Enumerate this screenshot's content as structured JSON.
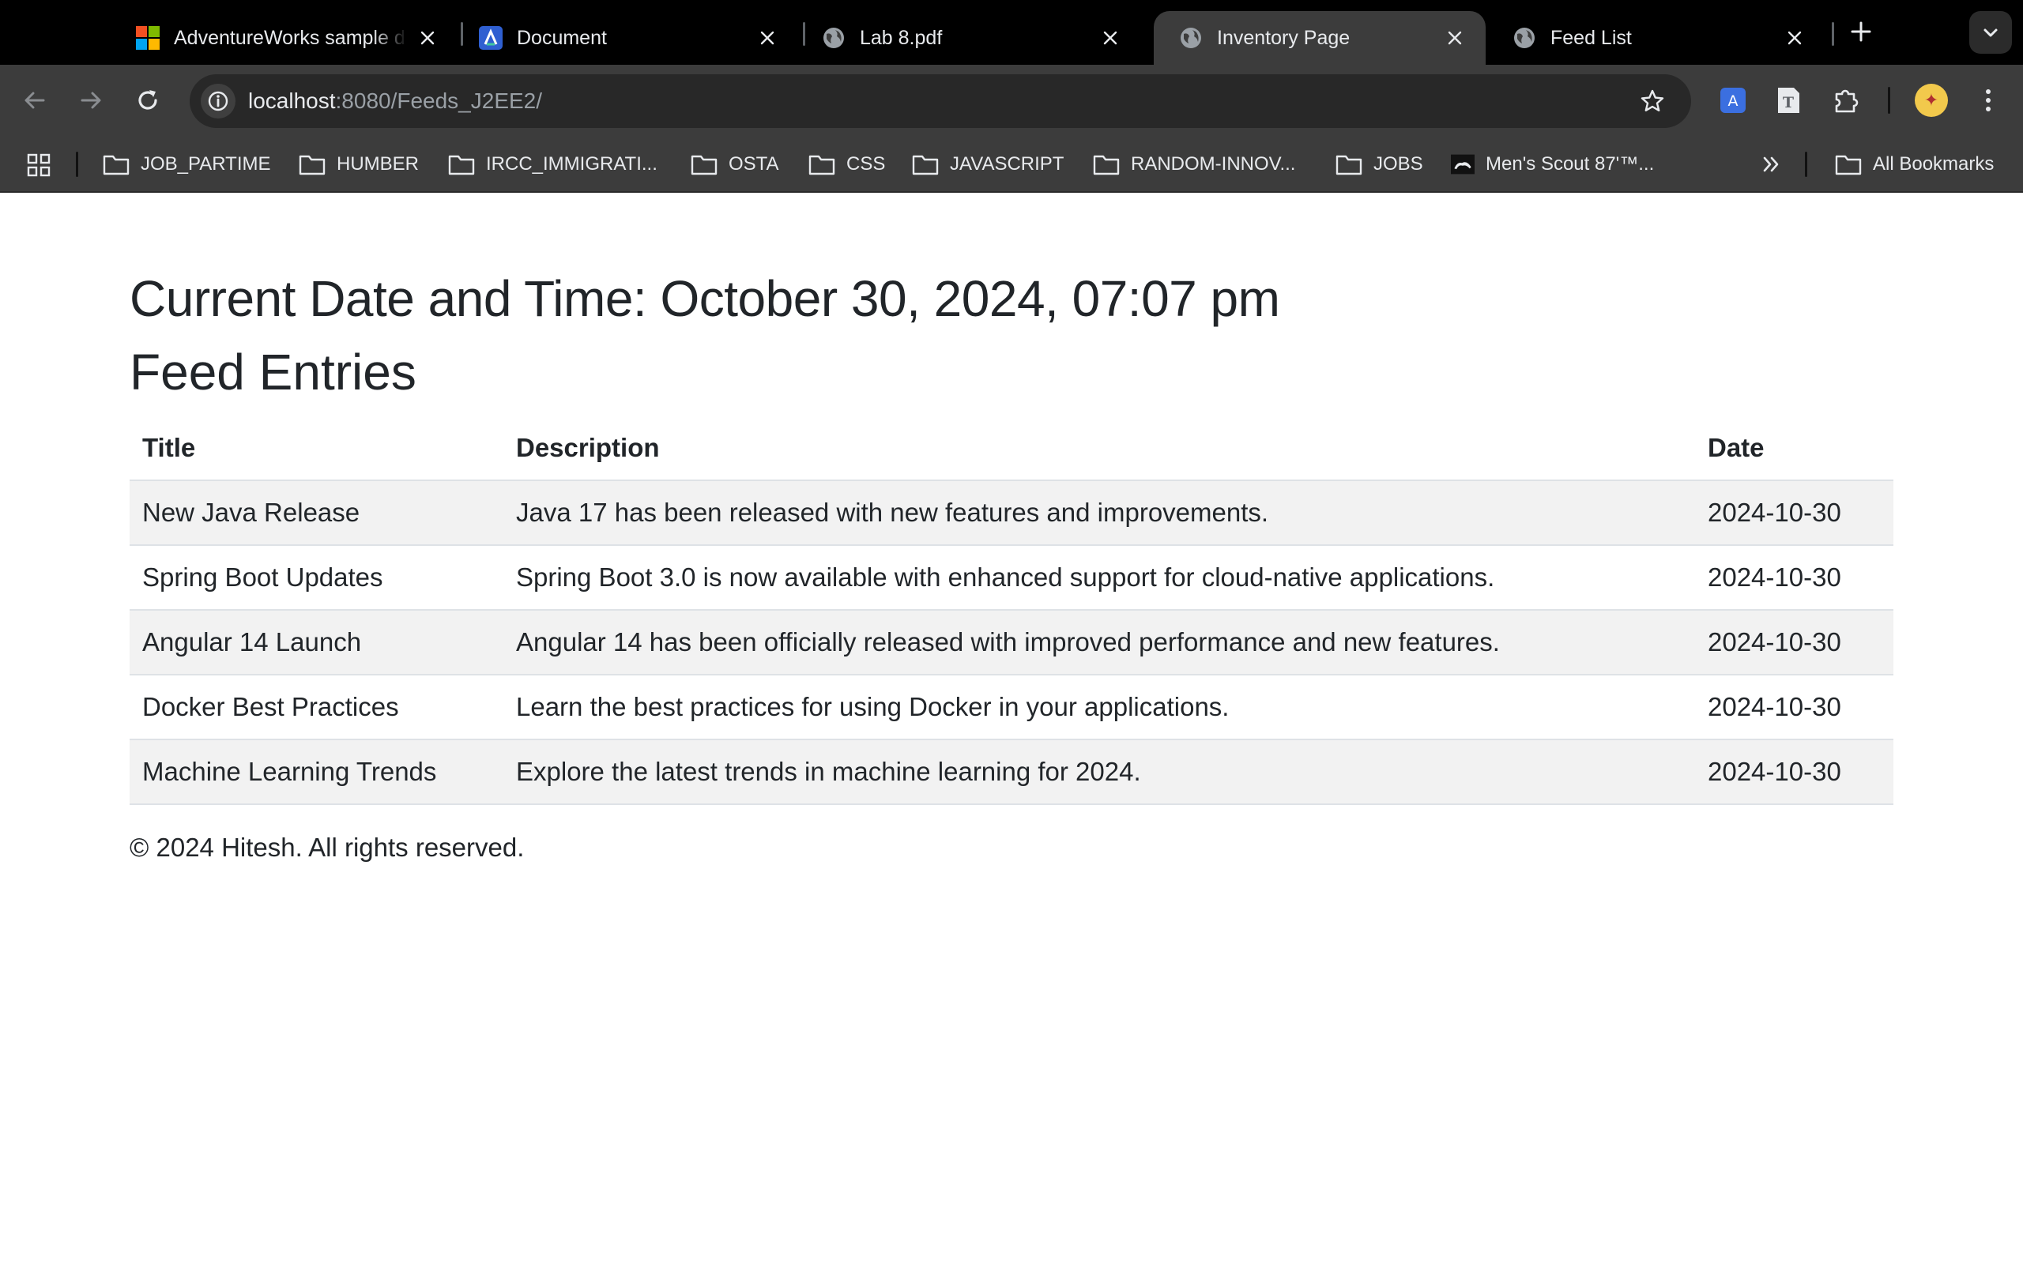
{
  "browser": {
    "tabs": [
      {
        "title": "AdventureWorks sample d",
        "favicon": "microsoft-logo",
        "active": false
      },
      {
        "title": "Document",
        "favicon": "document-app-logo",
        "active": false
      },
      {
        "title": "Lab 8.pdf",
        "favicon": "globe-icon",
        "active": false
      },
      {
        "title": "Inventory Page",
        "favicon": "globe-icon",
        "active": true
      },
      {
        "title": "Feed List",
        "favicon": "globe-icon",
        "active": false
      }
    ],
    "url_host": "localhost",
    "url_path": ":8080/Feeds_J2EE2/",
    "bookmarks": [
      {
        "label": "JOB_PARTIME"
      },
      {
        "label": "HUMBER"
      },
      {
        "label": "IRCC_IMMIGRATI..."
      },
      {
        "label": "OSTA"
      },
      {
        "label": "CSS"
      },
      {
        "label": "JAVASCRIPT"
      },
      {
        "label": "RANDOM-INNOV..."
      },
      {
        "label": "JOBS"
      },
      {
        "label": "Men's Scout 87'™..."
      }
    ],
    "all_bookmarks_label": "All Bookmarks"
  },
  "page": {
    "datetime_heading": "Current Date and Time: October 30, 2024, 07:07 pm",
    "feeds_heading": "Feed Entries",
    "table": {
      "headers": {
        "title": "Title",
        "description": "Description",
        "date": "Date"
      },
      "rows": [
        {
          "title": "New Java Release",
          "description": "Java 17 has been released with new features and improvements.",
          "date": "2024-10-30"
        },
        {
          "title": "Spring Boot Updates",
          "description": "Spring Boot 3.0 is now available with enhanced support for cloud-native applications.",
          "date": "2024-10-30"
        },
        {
          "title": "Angular 14 Launch",
          "description": "Angular 14 has been officially released with improved performance and new features.",
          "date": "2024-10-30"
        },
        {
          "title": "Docker Best Practices",
          "description": "Learn the best practices for using Docker in your applications.",
          "date": "2024-10-30"
        },
        {
          "title": "Machine Learning Trends",
          "description": "Explore the latest trends in machine learning for 2024.",
          "date": "2024-10-30"
        }
      ]
    },
    "footer": "© 2024 Hitesh. All rights reserved."
  },
  "colors": {
    "tab_strip": "#000000",
    "toolbar": "#3c3c3c",
    "omnibox": "#282828",
    "row_stripe": "#f2f2f2",
    "text": "#212529"
  }
}
